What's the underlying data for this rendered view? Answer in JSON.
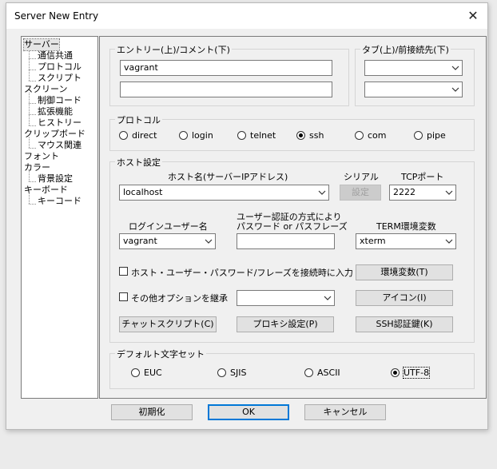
{
  "window": {
    "title": "Server New Entry",
    "close_glyph": "✕"
  },
  "tree": {
    "items": [
      {
        "label": "サーバー",
        "selected": true
      },
      {
        "label": "通信共通"
      },
      {
        "label": "プロトコル"
      },
      {
        "label": "スクリプト"
      },
      {
        "label": "スクリーン"
      },
      {
        "label": "制御コード"
      },
      {
        "label": "拡張機能"
      },
      {
        "label": "ヒストリー"
      },
      {
        "label": "クリップボード"
      },
      {
        "label": "マウス関連"
      },
      {
        "label": "フォント"
      },
      {
        "label": "カラー"
      },
      {
        "label": "背景設定"
      },
      {
        "label": "キーボード"
      },
      {
        "label": "キーコード"
      }
    ]
  },
  "entry_group": {
    "label": "エントリー(上)/コメント(下)",
    "entry_value": "vagrant",
    "comment_value": ""
  },
  "tab_group": {
    "label": "タブ(上)/前接続先(下)",
    "tab_value": "",
    "prev_value": ""
  },
  "protocol_group": {
    "label": "プロトコル",
    "options": [
      {
        "label": "direct",
        "selected": false
      },
      {
        "label": "login",
        "selected": false
      },
      {
        "label": "telnet",
        "selected": false
      },
      {
        "label": "ssh",
        "selected": true
      },
      {
        "label": "com",
        "selected": false
      },
      {
        "label": "pipe",
        "selected": false
      }
    ]
  },
  "host_group": {
    "label": "ホスト設定",
    "host_label": "ホスト名(サーバーIPアドレス)",
    "host_value": "localhost",
    "serial_label": "シリアル",
    "serial_button": "設定",
    "port_label": "TCPポート",
    "port_value": "2222",
    "login_label": "ログインユーザー名",
    "login_value": "vagrant",
    "auth_label_line1": "ユーザー認証の方式により",
    "auth_label_line2": "パスワード or パスフレーズ",
    "password_value": "",
    "term_label": "TERM環境変数",
    "term_value": "xterm",
    "save_checkbox_label": "ホスト・ユーザー・パスワード/フレーズを接続時に入力",
    "save_checked": false,
    "inherit_checkbox_label": "その他オプションを継承",
    "inherit_checked": false,
    "inherit_value": "",
    "env_button": "環境変数(T)",
    "icon_button": "アイコン(I)",
    "chat_button": "チャットスクリプト(C)",
    "proxy_button": "プロキシ設定(P)",
    "ssh_button": "SSH認証鍵(K)"
  },
  "charset_group": {
    "label": "デフォルト文字セット",
    "options": [
      {
        "label": "EUC",
        "selected": false
      },
      {
        "label": "SJIS",
        "selected": false
      },
      {
        "label": "ASCII",
        "selected": false
      },
      {
        "label": "UTF-8",
        "selected": true
      }
    ]
  },
  "footer": {
    "init_button": "初期化",
    "ok_button": "OK",
    "cancel_button": "キャンセル"
  },
  "colors": {
    "accent": "#0078d7",
    "dialog_bg": "#f0f0f0",
    "border": "#7a7a7a"
  }
}
